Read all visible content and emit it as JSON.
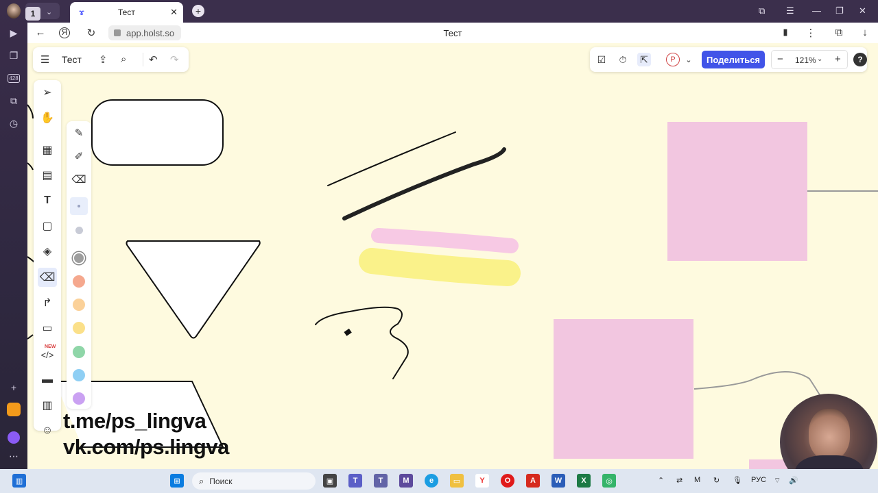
{
  "browser": {
    "tab_count": "1",
    "tab_title": "Тест",
    "url": "app.holst.so",
    "page_title": "Тест",
    "rail_badge": "428"
  },
  "board": {
    "name": "Тест",
    "share_label": "Поделиться",
    "zoom": "121%",
    "presence_initial": "Р",
    "help": "?",
    "new_badge": "NEW"
  },
  "swatches": [
    "#9e9e9e",
    "#f5a88e",
    "#fbd199",
    "#fbe089",
    "#8fd6a8",
    "#8fcff4",
    "#caa1f2"
  ],
  "watermark": {
    "line1": "t.me/ps_lingva",
    "line2": "vk.com/ps.lingva"
  },
  "taskbar": {
    "search_placeholder": "Поиск",
    "lang": "РУС"
  },
  "colors": {
    "canvas_bg": "#fefadf",
    "accent": "#4154e8",
    "sticky_pink": "#f2c6e0",
    "highlight_pink": "#f7c9e4",
    "highlight_yellow": "#faf28a"
  }
}
